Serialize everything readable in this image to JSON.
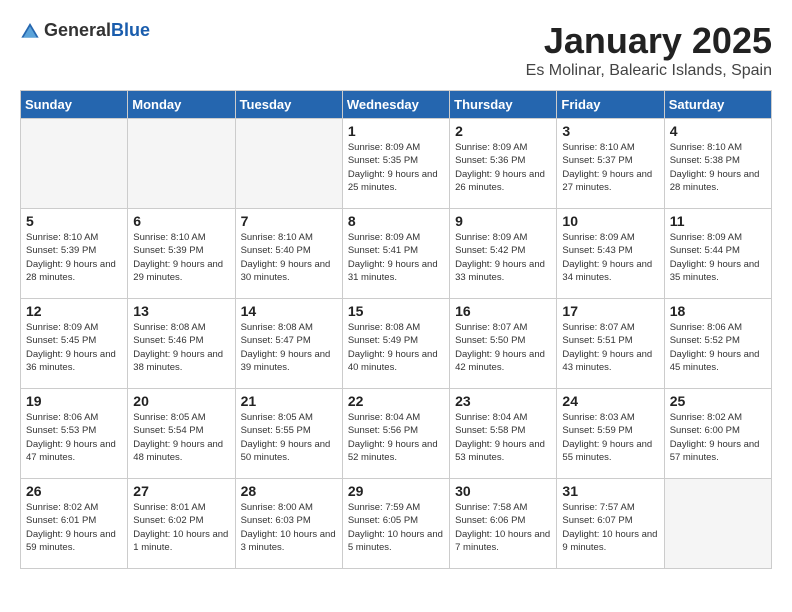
{
  "header": {
    "logo_general": "General",
    "logo_blue": "Blue",
    "month_title": "January 2025",
    "location": "Es Molinar, Balearic Islands, Spain"
  },
  "days_of_week": [
    "Sunday",
    "Monday",
    "Tuesday",
    "Wednesday",
    "Thursday",
    "Friday",
    "Saturday"
  ],
  "weeks": [
    [
      {
        "day": "",
        "empty": true
      },
      {
        "day": "",
        "empty": true
      },
      {
        "day": "",
        "empty": true
      },
      {
        "day": "1",
        "sunrise": "8:09 AM",
        "sunset": "5:35 PM",
        "daylight": "9 hours and 25 minutes."
      },
      {
        "day": "2",
        "sunrise": "8:09 AM",
        "sunset": "5:36 PM",
        "daylight": "9 hours and 26 minutes."
      },
      {
        "day": "3",
        "sunrise": "8:10 AM",
        "sunset": "5:37 PM",
        "daylight": "9 hours and 27 minutes."
      },
      {
        "day": "4",
        "sunrise": "8:10 AM",
        "sunset": "5:38 PM",
        "daylight": "9 hours and 28 minutes."
      }
    ],
    [
      {
        "day": "5",
        "sunrise": "8:10 AM",
        "sunset": "5:39 PM",
        "daylight": "9 hours and 28 minutes."
      },
      {
        "day": "6",
        "sunrise": "8:10 AM",
        "sunset": "5:39 PM",
        "daylight": "9 hours and 29 minutes."
      },
      {
        "day": "7",
        "sunrise": "8:10 AM",
        "sunset": "5:40 PM",
        "daylight": "9 hours and 30 minutes."
      },
      {
        "day": "8",
        "sunrise": "8:09 AM",
        "sunset": "5:41 PM",
        "daylight": "9 hours and 31 minutes."
      },
      {
        "day": "9",
        "sunrise": "8:09 AM",
        "sunset": "5:42 PM",
        "daylight": "9 hours and 33 minutes."
      },
      {
        "day": "10",
        "sunrise": "8:09 AM",
        "sunset": "5:43 PM",
        "daylight": "9 hours and 34 minutes."
      },
      {
        "day": "11",
        "sunrise": "8:09 AM",
        "sunset": "5:44 PM",
        "daylight": "9 hours and 35 minutes."
      }
    ],
    [
      {
        "day": "12",
        "sunrise": "8:09 AM",
        "sunset": "5:45 PM",
        "daylight": "9 hours and 36 minutes."
      },
      {
        "day": "13",
        "sunrise": "8:08 AM",
        "sunset": "5:46 PM",
        "daylight": "9 hours and 38 minutes."
      },
      {
        "day": "14",
        "sunrise": "8:08 AM",
        "sunset": "5:47 PM",
        "daylight": "9 hours and 39 minutes."
      },
      {
        "day": "15",
        "sunrise": "8:08 AM",
        "sunset": "5:49 PM",
        "daylight": "9 hours and 40 minutes."
      },
      {
        "day": "16",
        "sunrise": "8:07 AM",
        "sunset": "5:50 PM",
        "daylight": "9 hours and 42 minutes."
      },
      {
        "day": "17",
        "sunrise": "8:07 AM",
        "sunset": "5:51 PM",
        "daylight": "9 hours and 43 minutes."
      },
      {
        "day": "18",
        "sunrise": "8:06 AM",
        "sunset": "5:52 PM",
        "daylight": "9 hours and 45 minutes."
      }
    ],
    [
      {
        "day": "19",
        "sunrise": "8:06 AM",
        "sunset": "5:53 PM",
        "daylight": "9 hours and 47 minutes."
      },
      {
        "day": "20",
        "sunrise": "8:05 AM",
        "sunset": "5:54 PM",
        "daylight": "9 hours and 48 minutes."
      },
      {
        "day": "21",
        "sunrise": "8:05 AM",
        "sunset": "5:55 PM",
        "daylight": "9 hours and 50 minutes."
      },
      {
        "day": "22",
        "sunrise": "8:04 AM",
        "sunset": "5:56 PM",
        "daylight": "9 hours and 52 minutes."
      },
      {
        "day": "23",
        "sunrise": "8:04 AM",
        "sunset": "5:58 PM",
        "daylight": "9 hours and 53 minutes."
      },
      {
        "day": "24",
        "sunrise": "8:03 AM",
        "sunset": "5:59 PM",
        "daylight": "9 hours and 55 minutes."
      },
      {
        "day": "25",
        "sunrise": "8:02 AM",
        "sunset": "6:00 PM",
        "daylight": "9 hours and 57 minutes."
      }
    ],
    [
      {
        "day": "26",
        "sunrise": "8:02 AM",
        "sunset": "6:01 PM",
        "daylight": "9 hours and 59 minutes."
      },
      {
        "day": "27",
        "sunrise": "8:01 AM",
        "sunset": "6:02 PM",
        "daylight": "10 hours and 1 minute."
      },
      {
        "day": "28",
        "sunrise": "8:00 AM",
        "sunset": "6:03 PM",
        "daylight": "10 hours and 3 minutes."
      },
      {
        "day": "29",
        "sunrise": "7:59 AM",
        "sunset": "6:05 PM",
        "daylight": "10 hours and 5 minutes."
      },
      {
        "day": "30",
        "sunrise": "7:58 AM",
        "sunset": "6:06 PM",
        "daylight": "10 hours and 7 minutes."
      },
      {
        "day": "31",
        "sunrise": "7:57 AM",
        "sunset": "6:07 PM",
        "daylight": "10 hours and 9 minutes."
      },
      {
        "day": "",
        "empty": true
      }
    ]
  ]
}
